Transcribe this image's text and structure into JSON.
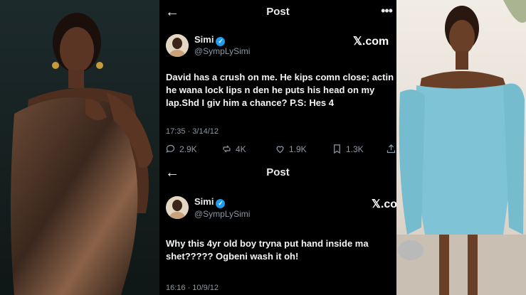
{
  "posts": [
    {
      "header_title": "Post",
      "author": {
        "name": "Simi",
        "handle": "@SympLySimi"
      },
      "site_badge": "𝕏.com",
      "text": "David has a crush on me. He kips comn close; actin lik he wana lock lips n den he puts his head on my lap.Shd I giv him a chance? P.S: Hes 4",
      "timestamp": "17:35 · 3/14/12",
      "stats": {
        "replies": "2.9K",
        "reposts": "4K",
        "likes": "1.9K",
        "bookmarks": "1.3K"
      }
    },
    {
      "header_title": "Post",
      "author": {
        "name": "Simi",
        "handle": "@SympLySimi"
      },
      "site_badge": "𝕏.co",
      "text": "Why this 4yr old boy tryna put hand inside ma shet????? Ogbeni wash it oh!",
      "timestamp": "16:16 · 10/9/12"
    }
  ],
  "colors": {
    "accent": "#1d9bf0",
    "background": "#000000",
    "muted": "#8b98a5"
  },
  "icons": [
    "back-arrow-icon",
    "more-icon",
    "verified-badge-icon",
    "reply-icon",
    "repost-icon",
    "like-icon",
    "bookmark-icon",
    "share-icon"
  ]
}
